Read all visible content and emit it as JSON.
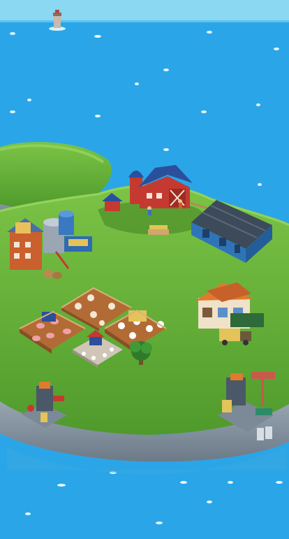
{
  "scene": {
    "water": "ocean",
    "colors": {
      "sky": "#8ad8f2",
      "ocean": "#2aa6e8",
      "ocean_light": "#4bbdf2",
      "grass": "#5faa35",
      "grass_light": "#7fc446",
      "cliff": "#8a98a6",
      "field_soil": "#b36b35",
      "barn_red": "#c43a30",
      "roof_blue": "#2c4f9c",
      "warehouse_blue": "#2f74b8",
      "warehouse_roof": "#3d4a5a"
    }
  },
  "buildings": [
    {
      "id": "lighthouse",
      "icon": "lighthouse-icon"
    },
    {
      "id": "farmhouse-barn",
      "icon": "barn-icon"
    },
    {
      "id": "warehouse",
      "icon": "warehouse-icon"
    },
    {
      "id": "feed-mill",
      "icon": "factory-icon"
    },
    {
      "id": "bakery",
      "icon": "bakery-icon"
    },
    {
      "id": "cow-pen",
      "icon": "cow-icon"
    },
    {
      "id": "pig-pen",
      "icon": "pig-icon"
    },
    {
      "id": "sheep-pen",
      "icon": "sheep-icon"
    },
    {
      "id": "chicken-coop",
      "icon": "chicken-icon"
    },
    {
      "id": "crane-left",
      "icon": "crane-icon"
    },
    {
      "id": "crane-right",
      "icon": "crane-icon"
    },
    {
      "id": "tree",
      "icon": "tree-icon"
    }
  ]
}
